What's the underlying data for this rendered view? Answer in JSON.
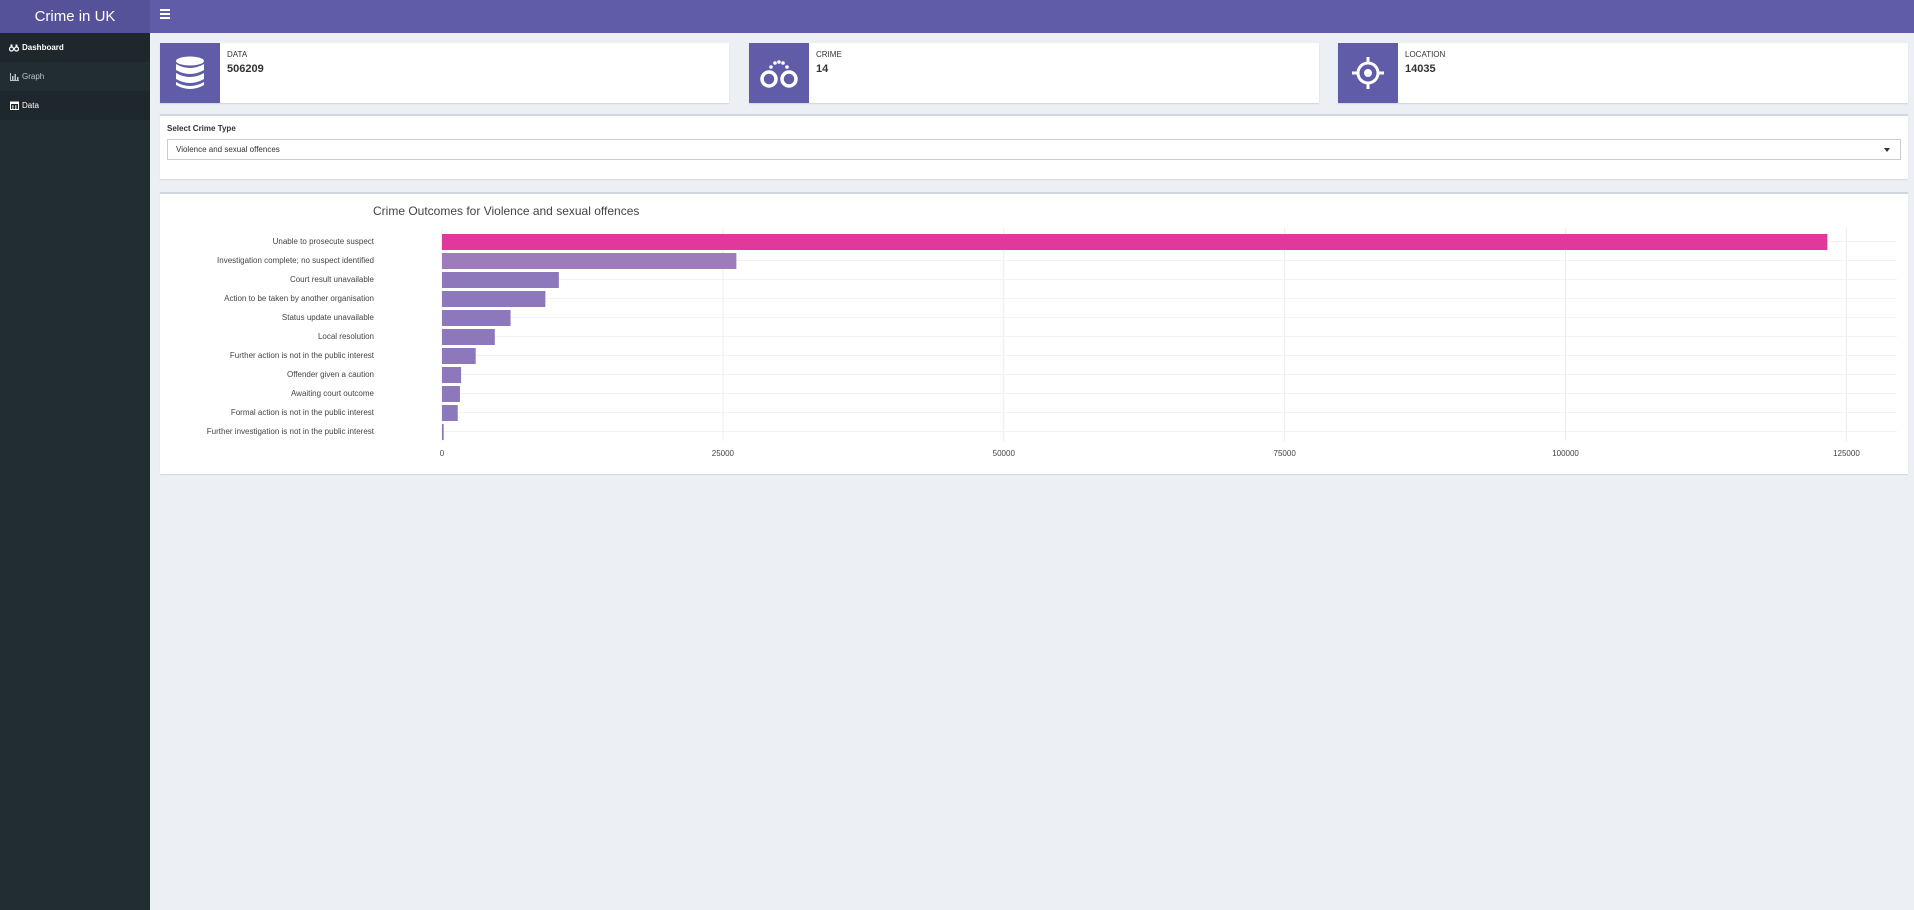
{
  "app": {
    "title": "Crime in UK"
  },
  "sidebar": {
    "items": [
      {
        "label": "Dashboard",
        "icon": "binoculars-icon"
      },
      {
        "label": "Graph",
        "icon": "bar-chart-icon"
      },
      {
        "label": "Data",
        "icon": "calendar-icon"
      }
    ]
  },
  "infoboxes": [
    {
      "label": "DATA",
      "value": "506209",
      "icon": "database-icon"
    },
    {
      "label": "CRIME",
      "value": "14",
      "icon": "handcuffs-icon"
    },
    {
      "label": "LOCATION",
      "value": "14035",
      "icon": "crosshair-icon"
    }
  ],
  "filter": {
    "label": "Select Crime Type",
    "selected": "Violence and sexual offences"
  },
  "colors": {
    "accent": "#605ca8",
    "highlight_bar": "#e0399b",
    "bar": "#8c78bb"
  },
  "chart_data": {
    "type": "bar",
    "orientation": "horizontal",
    "title": "Crime Outcomes for Violence and sexual offences",
    "categories": [
      "Unable to prosecute suspect",
      "Investigation complete; no suspect identified",
      "Court result unavailable",
      "Action to be taken by another organisation",
      "Status update unavailable",
      "Local resolution",
      "Further action is not in the public interest",
      "Offender given a caution",
      "Awaiting court outcome",
      "Formal action is not in the public interest",
      "Further investigation is not in the public interest"
    ],
    "values": [
      123300,
      26200,
      10400,
      9200,
      6100,
      4700,
      3000,
      1700,
      1600,
      1400,
      150
    ],
    "xlim": [
      0,
      129500
    ],
    "xticks": [
      0,
      25000,
      50000,
      75000,
      100000,
      125000
    ],
    "xtick_labels": [
      "0",
      "25000",
      "50000",
      "75000",
      "100000",
      "125000"
    ],
    "grid": true,
    "xlabel": "",
    "ylabel": ""
  }
}
